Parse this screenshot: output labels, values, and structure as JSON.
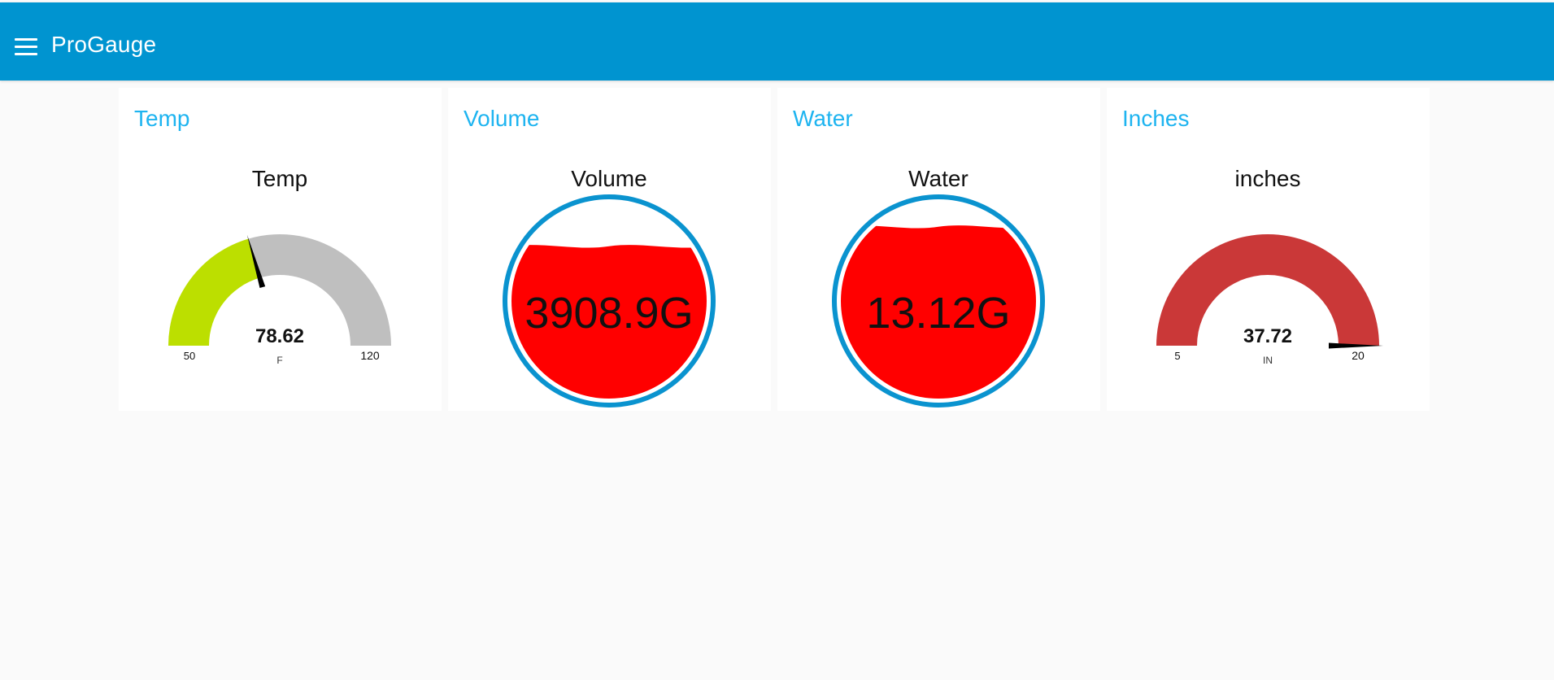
{
  "app": {
    "title": "ProGauge",
    "menu_icon": "hamburger-menu-icon",
    "header_color": "#0094d0",
    "card_title_color": "#1eb4f0"
  },
  "widgets": [
    {
      "id": "temp",
      "group_title": "Temp",
      "type": "gauge",
      "label": "Temp",
      "value": 78.62,
      "value_text": "78.62",
      "units": "F",
      "min": 50,
      "max": 120,
      "min_text": "50",
      "max_text": "120",
      "fill_color": "#bcdf00",
      "track_color": "#bfbfbf"
    },
    {
      "id": "volume",
      "group_title": "Volume",
      "type": "level",
      "label": "Volume",
      "value_text": "3908.9G",
      "fill_fraction": 0.78,
      "fill_color": "#ff0000",
      "ring_color": "#0a93cf"
    },
    {
      "id": "water",
      "group_title": "Water",
      "type": "level",
      "label": "Water",
      "value_text": "13.12G",
      "fill_fraction": 0.88,
      "fill_color": "#ff0000",
      "ring_color": "#0a93cf"
    },
    {
      "id": "inches",
      "group_title": "Inches",
      "type": "gauge",
      "label": "inches",
      "value": 37.72,
      "value_text": "37.72",
      "units": "IN",
      "min": 5,
      "max": 20,
      "min_text": "5",
      "max_text": "20",
      "fill_color": "#ca3838",
      "track_color": "#bfbfbf"
    }
  ]
}
